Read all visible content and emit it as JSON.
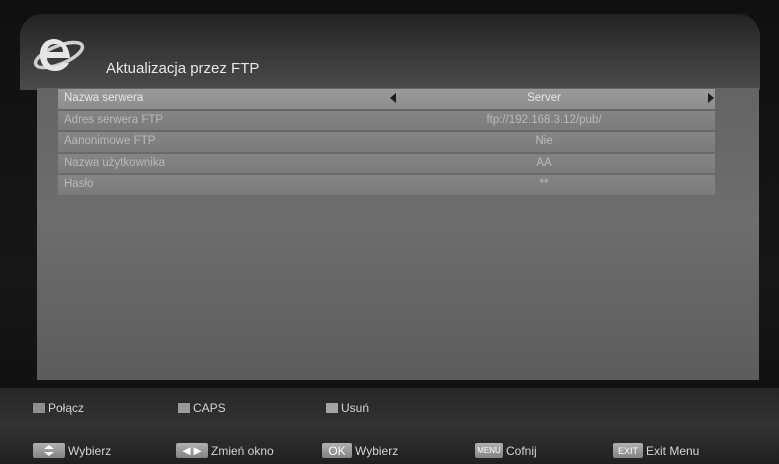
{
  "header": {
    "title": "Aktualizacja przez FTP"
  },
  "settings": {
    "rows": [
      {
        "label": "Nazwa serwera",
        "value": "Server"
      },
      {
        "label": "Adres serwera FTP",
        "value": "ftp://192.168.3.12/pub/"
      },
      {
        "label": "Aanonimowe FTP",
        "value": "Nie"
      },
      {
        "label": "Nazwa użytkownika",
        "value": "AA"
      },
      {
        "label": "Hasło",
        "value": "**"
      }
    ]
  },
  "color_buttons": {
    "red": "Połącz",
    "green": "CAPS",
    "yellow": "Usuń"
  },
  "hints": {
    "updown_action": "Wybierz",
    "leftright_key": "◀ ▶",
    "leftright_action": "Zmień okno",
    "ok_key": "OK",
    "ok_action": "Wybierz",
    "menu_key": "MENU",
    "menu_action": "Cofnij",
    "exit_key": "EXIT",
    "exit_action": "Exit Menu"
  },
  "icons": [
    "ie-logo-icon",
    "arrow-left-icon",
    "arrow-right-icon",
    "up-down-arrows-icon"
  ]
}
